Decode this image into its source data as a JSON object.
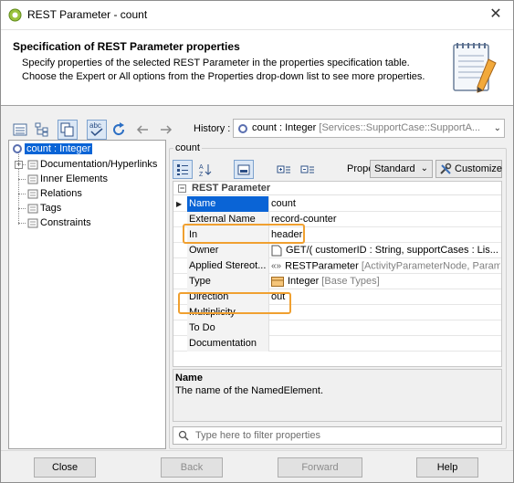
{
  "window": {
    "title": "REST Parameter - count",
    "close_glyph": "✕"
  },
  "header": {
    "title": "Specification of REST Parameter properties",
    "desc_line1": "Specify properties of the selected REST Parameter in the properties specification table.",
    "desc_line2": "Choose the Expert or All options from the Properties drop-down list to see more properties."
  },
  "history": {
    "label": "History :",
    "value": "count : Integer",
    "path": " [Services::SupportCase::SupportA..."
  },
  "tree": {
    "items": [
      {
        "label": "count : Integer",
        "selected": true
      },
      {
        "label": "Documentation/Hyperlinks",
        "expandable": true
      },
      {
        "label": "Inner Elements"
      },
      {
        "label": "Relations"
      },
      {
        "label": "Tags"
      },
      {
        "label": "Constraints"
      }
    ]
  },
  "panel": {
    "group_title": "count",
    "properties_label": "Properties:",
    "properties_mode": "Standard",
    "customize_label": "Customize"
  },
  "grid": {
    "section": "REST Parameter",
    "rows": [
      {
        "name": "Name",
        "value": "count",
        "selected": true
      },
      {
        "name": "External Name",
        "value": "record-counter"
      },
      {
        "name": "In",
        "value": "header"
      },
      {
        "name": "Owner",
        "value": "GET/( customerID : String, supportCases : Lis..."
      },
      {
        "name": "Applied Stereot...",
        "value": "RESTParameter",
        "value_gray": " [ActivityParameterNode, Param"
      },
      {
        "name": "Type",
        "value": "Integer",
        "value_gray": " [Base Types]"
      },
      {
        "name": "Direction",
        "value": "out"
      },
      {
        "name": "Multiplicity",
        "value": ""
      },
      {
        "name": "To Do",
        "value": ""
      },
      {
        "name": "Documentation",
        "value": ""
      }
    ]
  },
  "description": {
    "title": "Name",
    "text": "The name of the NamedElement."
  },
  "filter": {
    "placeholder": "Type here to filter properties"
  },
  "footer": {
    "close": "Close",
    "back": "Back",
    "forward": "Forward",
    "help": "Help"
  },
  "colors": {
    "selection": "#0a64d6",
    "highlight": "#f0a030"
  }
}
